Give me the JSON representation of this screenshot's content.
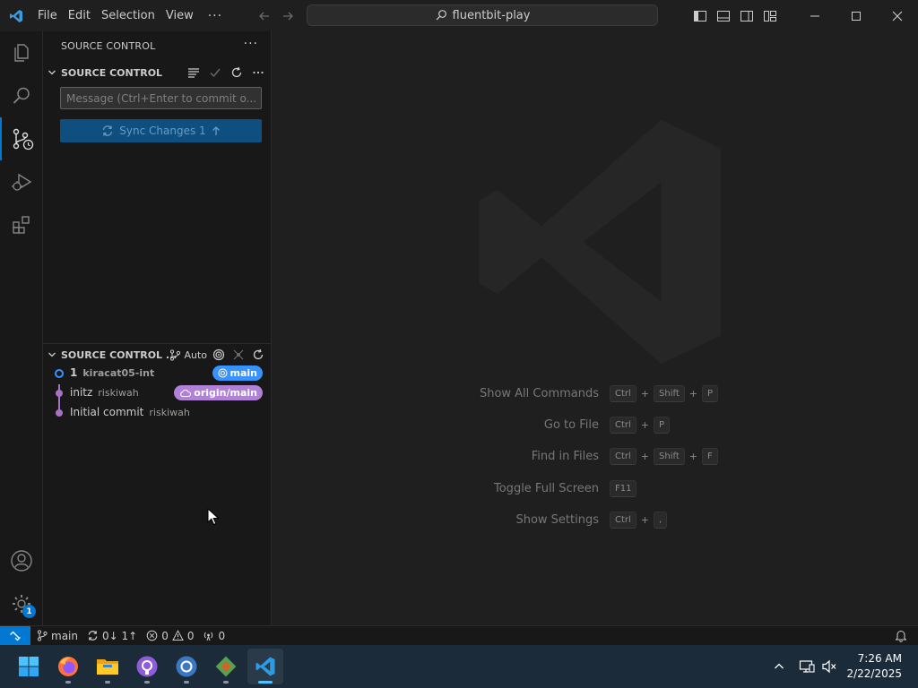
{
  "titlebar": {
    "menu": [
      "File",
      "Edit",
      "Selection",
      "View"
    ],
    "more": "···",
    "search_text": "fluentbit-play"
  },
  "activity_bar": {
    "items": [
      "explorer-icon",
      "search-icon",
      "source-control-icon",
      "run-debug-icon",
      "extensions-icon"
    ],
    "bottom": [
      "accounts-icon",
      "manage-gear-icon"
    ],
    "manage_badge": "1"
  },
  "sidebar": {
    "title": "SOURCE CONTROL",
    "more": "···",
    "scm_section": {
      "label": "SOURCE CONTROL",
      "commit_placeholder": "Message (Ctrl+Enter to commit o...",
      "sync_label": "Sync Changes 1"
    },
    "graph_section": {
      "label": "SOURCE CONTROL ...",
      "auto_label": "Auto",
      "commits": [
        {
          "title": "1",
          "author": "kiracat05-int",
          "ref": "main",
          "ref_color": "#3794ff"
        },
        {
          "title": "initz",
          "author": "riskiwah",
          "ref": "origin/main",
          "ref_color": "#b180d7"
        },
        {
          "title": "Initial commit",
          "author": "riskiwah",
          "ref": "",
          "ref_color": ""
        }
      ]
    }
  },
  "editor": {
    "shortcuts": [
      {
        "label": "Show All Commands",
        "keys": [
          "Ctrl",
          "Shift",
          "P"
        ]
      },
      {
        "label": "Go to File",
        "keys": [
          "Ctrl",
          "P"
        ]
      },
      {
        "label": "Find in Files",
        "keys": [
          "Ctrl",
          "Shift",
          "F"
        ]
      },
      {
        "label": "Toggle Full Screen",
        "keys": [
          "F11"
        ]
      },
      {
        "label": "Show Settings",
        "keys": [
          "Ctrl",
          ","
        ]
      }
    ]
  },
  "statusbar": {
    "branch": "main",
    "sync": "0↓ 1↑",
    "errors": "0",
    "warnings": "0",
    "ports": "0"
  },
  "taskbar": {
    "apps": [
      "windows-start-icon",
      "firefox-icon",
      "file-explorer-icon",
      "github-desktop-icon",
      "chrome-icon",
      "git-icon",
      "vscode-icon"
    ],
    "time": "7:26 AM",
    "date": "2/22/2025"
  },
  "colors": {
    "accent": "#0078d4",
    "main_badge": "#3794ff",
    "origin_badge": "#b180d7",
    "graph_line": "#a872c4"
  }
}
